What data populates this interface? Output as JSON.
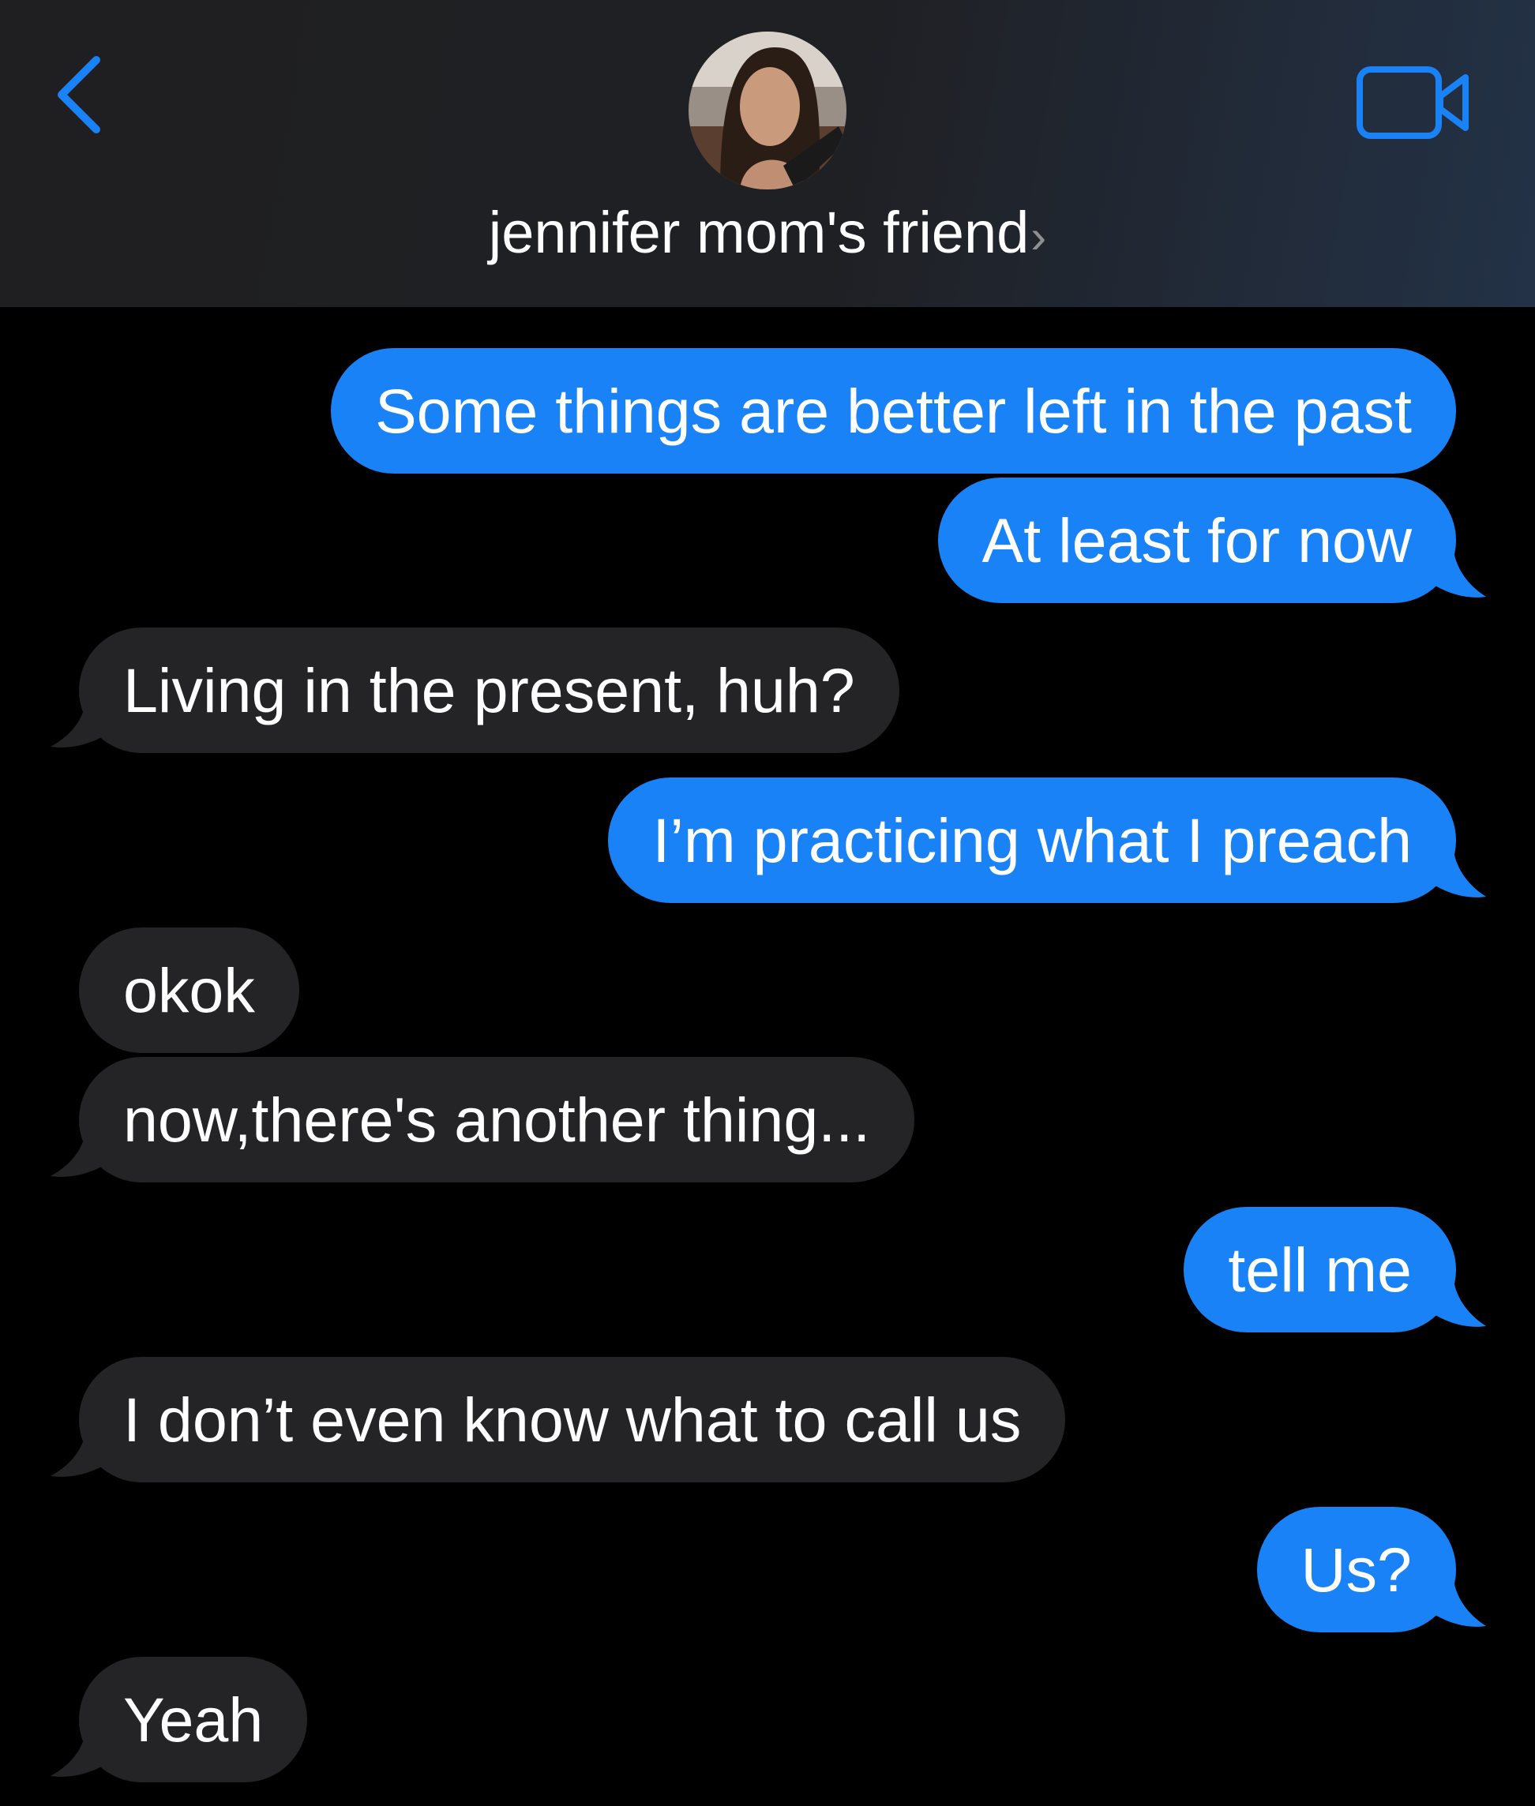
{
  "header": {
    "contact_name": "jennifer mom's friend",
    "chevron": "›"
  },
  "colors": {
    "sent_bubble": "#1a82f7",
    "received_bubble": "#242426",
    "accent": "#1a82f7",
    "background": "#000000"
  },
  "icons": {
    "back": "chevron-left-icon",
    "video": "video-camera-icon"
  },
  "messages": [
    {
      "direction": "sent",
      "text": "Some things are better left in the past"
    },
    {
      "direction": "sent",
      "text": "At least for now"
    },
    {
      "direction": "received",
      "text": "Living in the present, huh?"
    },
    {
      "direction": "sent",
      "text": "I’m practicing what I preach"
    },
    {
      "direction": "received",
      "text": "okok"
    },
    {
      "direction": "received",
      "text": "now,there's another thing..."
    },
    {
      "direction": "sent",
      "text": "tell me"
    },
    {
      "direction": "received",
      "text": "I don’t even know what to call us"
    },
    {
      "direction": "sent",
      "text": "Us?"
    },
    {
      "direction": "received",
      "text": "Yeah"
    }
  ]
}
